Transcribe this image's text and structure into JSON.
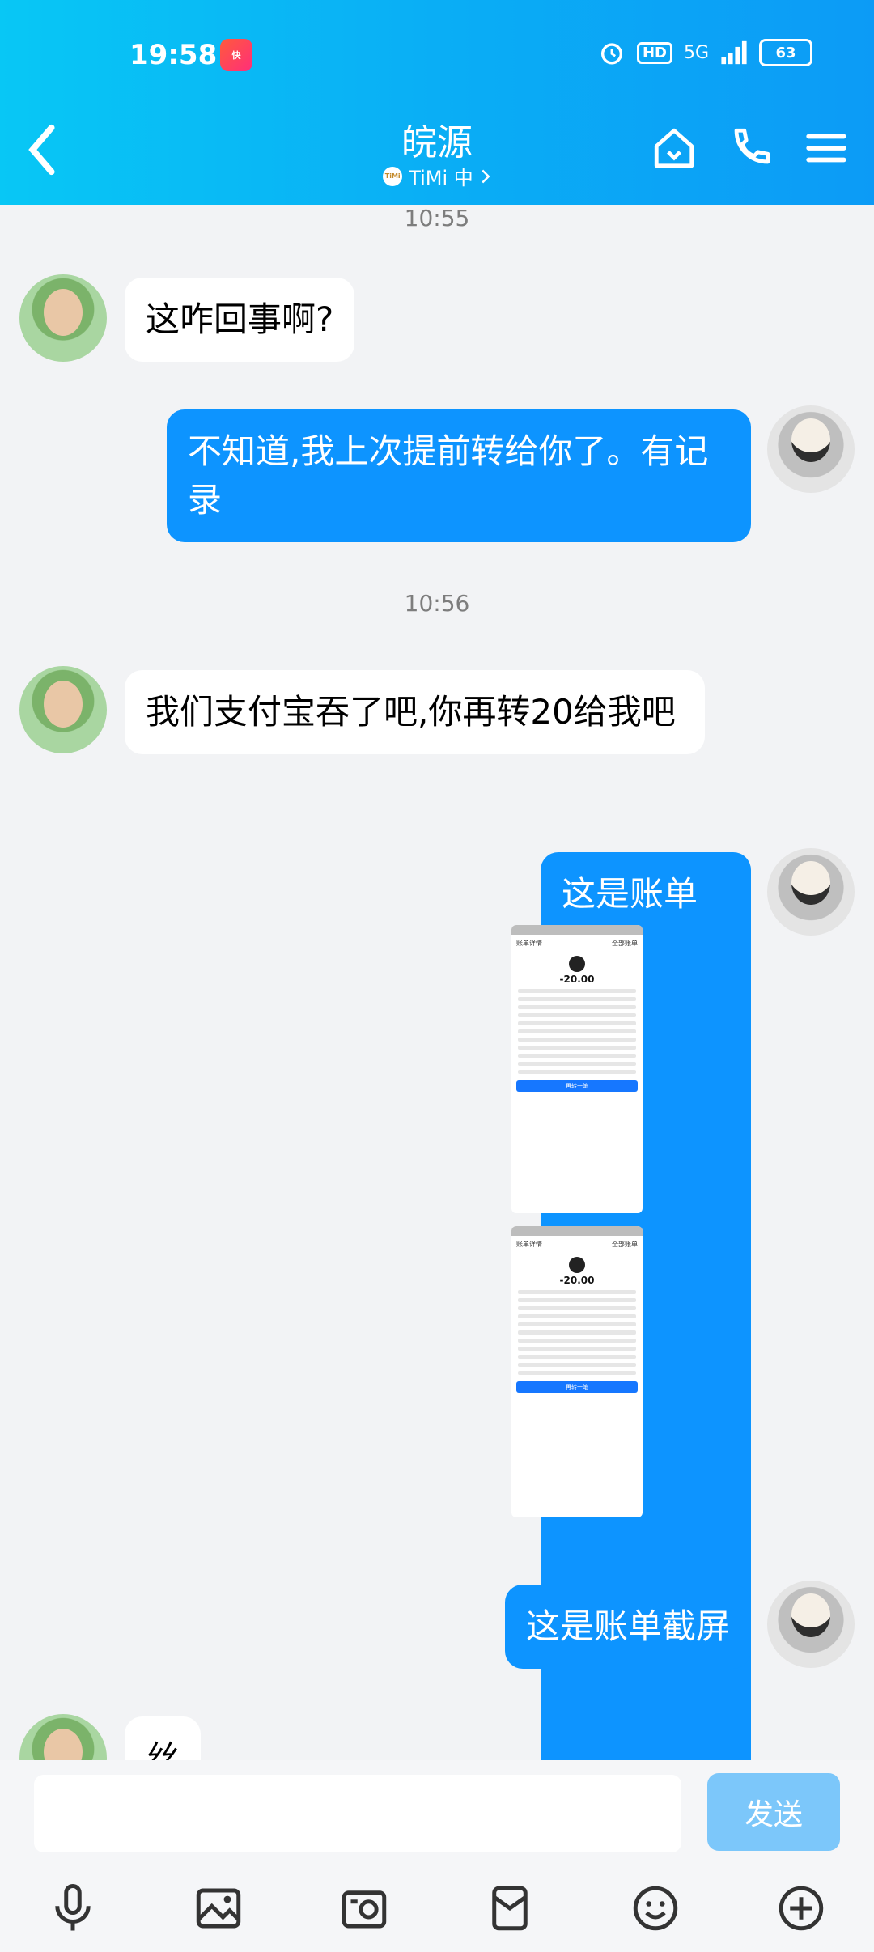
{
  "status": {
    "time": "19:58",
    "app_badge": "快",
    "hd": "HD",
    "signal": "5G",
    "battery": "63"
  },
  "nav": {
    "title": "皖源",
    "subtitle": "TiMi 中",
    "sub_logo": "TiMi"
  },
  "messages": {
    "t1": "10:55",
    "m1": "这咋回事啊?",
    "m2": "不知道,我上次提前转给你了。有记录",
    "t2": "10:56",
    "m3": "我们支付宝吞了吧,你再转20给我吧",
    "m4": "这是账单截屏",
    "m5": "这是账单截屏",
    "m6": "丝"
  },
  "screenshot": {
    "header_left": "账单详情",
    "header_right": "全部账单",
    "amount": "-20.00",
    "button": "再转一笔"
  },
  "input": {
    "placeholder": "",
    "send": "发送"
  },
  "icons": [
    "mic-icon",
    "photo-icon",
    "camera-icon",
    "red-packet-icon",
    "emoji-icon",
    "plus-icon"
  ]
}
